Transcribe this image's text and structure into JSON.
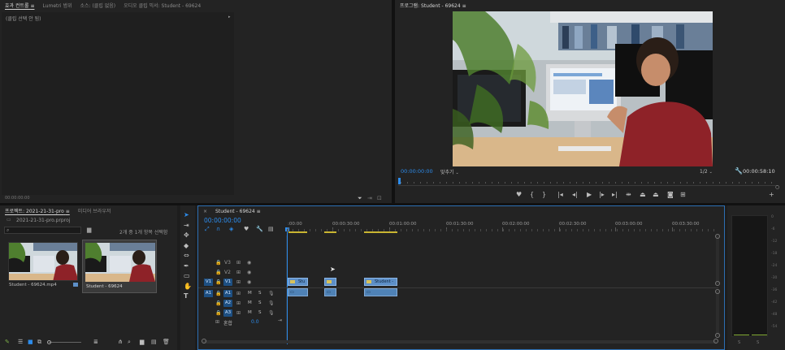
{
  "source_panel": {
    "tabs": [
      {
        "label": "효과 컨트롤",
        "active": true
      },
      {
        "label": "Lumetri 범위",
        "active": false
      },
      {
        "label": "소스: (클립 없음)",
        "active": false
      },
      {
        "label": "오디오 클립 믹서: Student - 69624",
        "active": false
      }
    ],
    "menu_glyph": "≡",
    "no_clip_text": "(클립 선택 안 됨)",
    "timecode": "00:00:00:00"
  },
  "program_monitor": {
    "title": "프로그램: Student - 69624",
    "menu_glyph": "≡",
    "timecode_current": "00:00:00:00",
    "fit_label": "맞추기",
    "resolution": "1/2",
    "timecode_duration": "00:00:58:10"
  },
  "project_panel": {
    "tabs": [
      {
        "label": "프로젝트: 2021-21-31-pro",
        "active": true
      },
      {
        "label": "미디어 브라우저",
        "active": false
      }
    ],
    "menu_glyph": "≡",
    "file_name": "2021-21-31-pro.prproj",
    "selection_status": "2개 중 1개 항목 선택함",
    "items": [
      {
        "name": "Student - 69624.mp4",
        "selected": false
      },
      {
        "name": "Student - 69624",
        "selected": true
      }
    ]
  },
  "timeline": {
    "title": "Student - 69624",
    "menu_glyph": "≡",
    "timecode": "00:00:00:00",
    "ruler": [
      ":00:00",
      "00:00:30:00",
      "00:01:00:00",
      "00:01:30:00",
      "00:02:00:00",
      "00:02:30:00",
      "00:03:00:00",
      "00:03:30:00"
    ],
    "video_tracks": [
      "V3",
      "V2",
      "V1"
    ],
    "audio_tracks": [
      "A1",
      "A2",
      "A3"
    ],
    "mute_label": "M",
    "solo_label": "S",
    "mix_label": "혼합",
    "mix_value": "0.0",
    "clips": [
      {
        "label": "Stu"
      },
      {
        "label": ""
      },
      {
        "label": "Student -"
      }
    ]
  },
  "audio_meter": {
    "scale": [
      "0",
      "-6",
      "-12",
      "-18",
      "-24",
      "-30",
      "-36",
      "-42",
      "-48",
      "-54"
    ],
    "channels": [
      "S",
      "S"
    ]
  },
  "colors": {
    "accent_blue": "#2d8ceb",
    "panel_bg": "#232323",
    "clip_video": "#5d8fc7",
    "clip_audio": "#4f82b6"
  }
}
